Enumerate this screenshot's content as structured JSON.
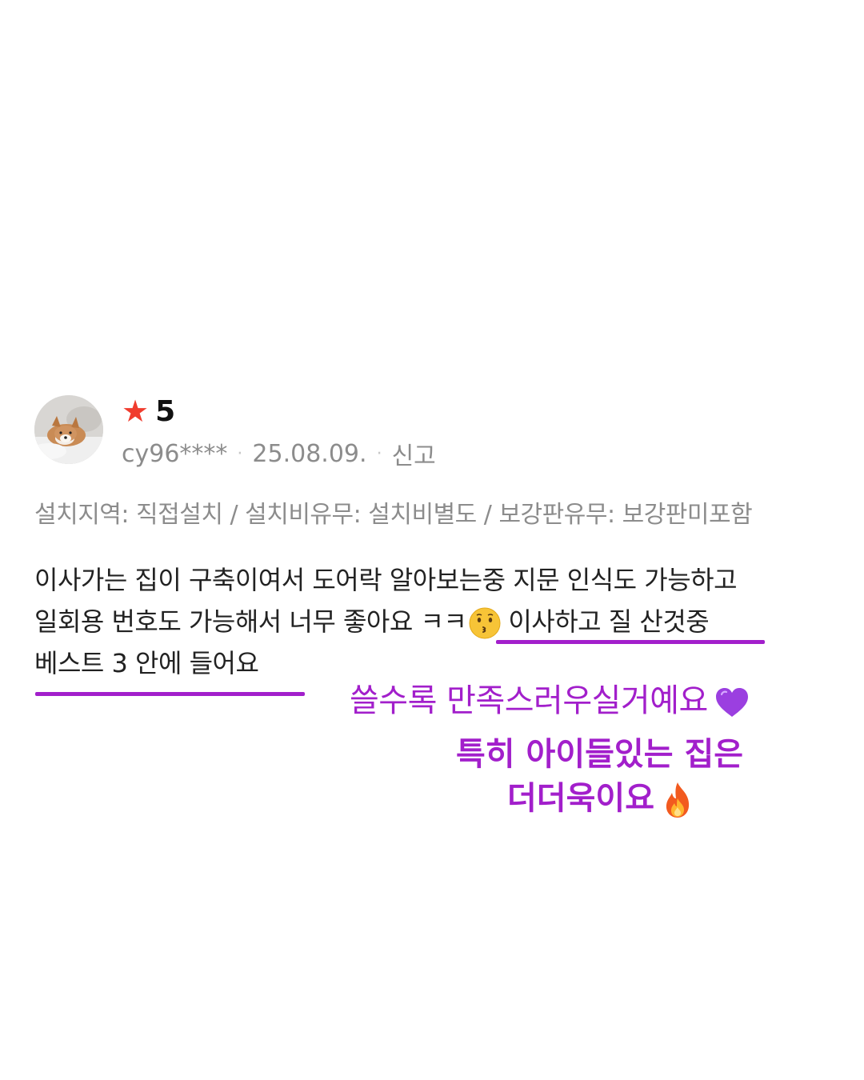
{
  "review": {
    "rating": {
      "star_icon": "star-icon",
      "star_color": "#f03c2e",
      "value": "5"
    },
    "meta": {
      "username": "cy96****",
      "separator": "·",
      "date": "25.08.09.",
      "report_label": "신고"
    },
    "options": "설치지역: 직접설치 / 설치비유무: 설치비별도 / 보강판유무: 보강판미포함",
    "body": {
      "line1": "이사가는 집이 구축이여서 도어락 알아보는중 지문 인식도 가능하고",
      "line2_prefix": "일회용 번호도 가능해서 너무 좋아요 ㅋㅋ",
      "line2_emoji": "kissing-face-emoji",
      "line2_suffix": "이사하고 질 산것중",
      "line3": "베스트 3 안에 들어요"
    }
  },
  "annotations": {
    "color": "#a21fcb",
    "note1": "쓸수록 만족스러우실거예요",
    "note1_icon": "purple-heart-icon",
    "note2": "특히 아이들있는 집은",
    "note3": "더더욱이요",
    "note3_icon": "fire-icon"
  }
}
